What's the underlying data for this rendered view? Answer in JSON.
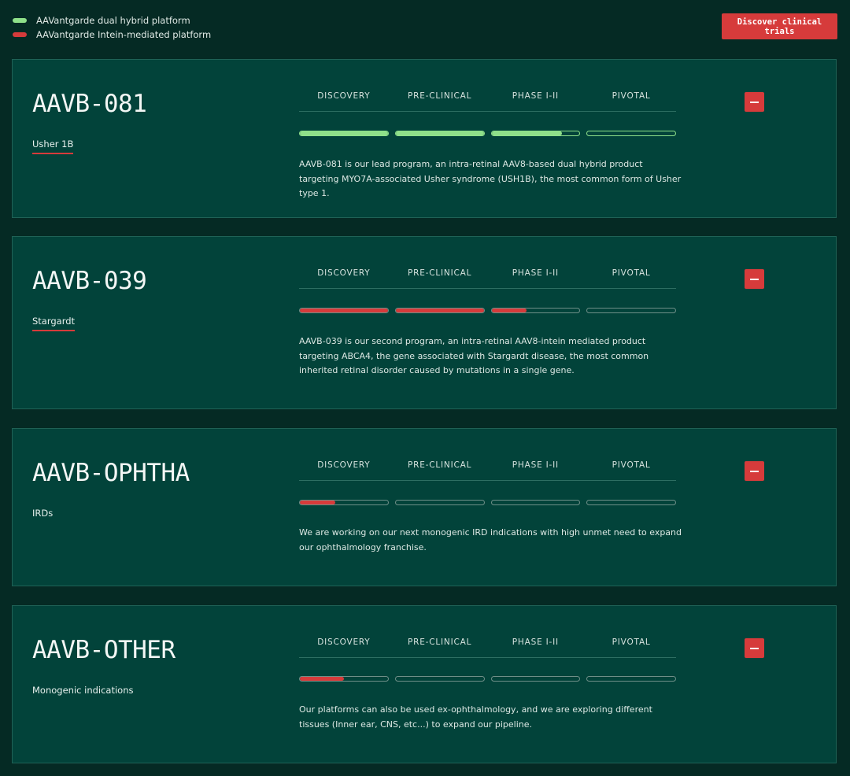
{
  "colors": {
    "background": "#052a24",
    "card": "#02433a",
    "dual_hybrid": "#8fe08a",
    "intein": "#d63b3b"
  },
  "legend": [
    {
      "label": "AAVantgarde dual hybrid platform",
      "color": "#8fe08a"
    },
    {
      "label": "AAVantgarde Intein-mediated platform",
      "color": "#d63b3b"
    }
  ],
  "cta_label": "Discover clinical trials",
  "stage_labels": [
    "DISCOVERY",
    "PRE-CLINICAL",
    "PHASE I-II",
    "PIVOTAL"
  ],
  "collapse_icon": "minus-icon",
  "programs": [
    {
      "title": "AAVB-081",
      "indication": "Usher 1B",
      "platform": "dual hybrid",
      "color": "#8fe08a",
      "progress": [
        1,
        1,
        0.8,
        0
      ],
      "description": "AAVB-081 is our lead program, an intra-retinal AAV8-based dual hybrid product targeting MYO7A-associated Usher syndrome (USH1B), the most common form of Usher type 1."
    },
    {
      "title": "AAVB-039",
      "indication": "Stargardt",
      "platform": "intein",
      "color": "#d63b3b",
      "progress": [
        1,
        1,
        0.4,
        0
      ],
      "description": "AAVB-039 is our second program, an intra-retinal AAV8-intein mediated product targeting ABCA4, the gene associated with Stargardt disease, the most common inherited retinal disorder caused by mutations in a single gene."
    },
    {
      "title": "AAVB-OPHTHA",
      "indication": "IRDs",
      "platform": "intein",
      "color": "#d63b3b",
      "progress": [
        0.4,
        0,
        0,
        0
      ],
      "description": "We are working on our next monogenic IRD indications with high unmet need to expand our ophthalmology franchise."
    },
    {
      "title": "AAVB-OTHER",
      "indication": "Monogenic indications",
      "platform": "intein",
      "color": "#d63b3b",
      "progress": [
        0.5,
        0,
        0,
        0
      ],
      "description": "Our platforms can also be used ex-ophthalmology, and we are exploring  different tissues (Inner ear, CNS, etc...) to expand our pipeline."
    }
  ]
}
